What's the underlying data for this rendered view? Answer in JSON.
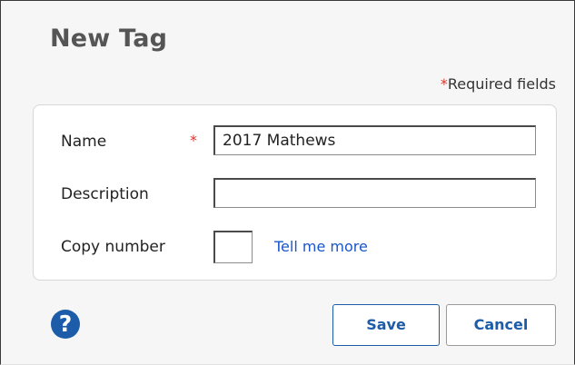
{
  "dialog": {
    "title": "New Tag",
    "required_note_star": "*",
    "required_note_text": "Required fields"
  },
  "form": {
    "name": {
      "label": "Name",
      "required_star": "*",
      "value": "2017 Mathews"
    },
    "description": {
      "label": "Description",
      "value": ""
    },
    "copy_number": {
      "label": "Copy number",
      "value": "",
      "help_link": "Tell me more"
    }
  },
  "footer": {
    "help_icon_glyph": "?",
    "help_icon": "question-mark-circle",
    "save_label": "Save",
    "cancel_label": "Cancel"
  },
  "colors": {
    "accent": "#1c5ca8",
    "required": "#d9342b",
    "link": "#1a56c9",
    "title": "#555555",
    "panel_background": "#f6f6f6"
  }
}
